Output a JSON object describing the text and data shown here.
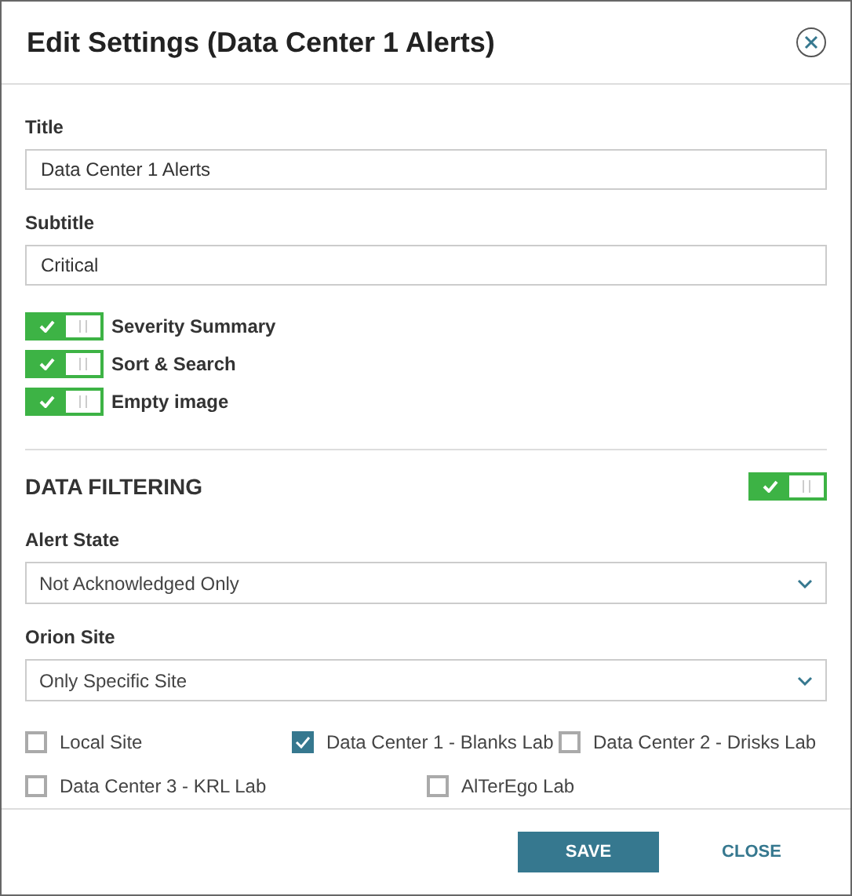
{
  "dialog": {
    "title": "Edit Settings (Data Center 1 Alerts)"
  },
  "fields": [
    {
      "label": "Title",
      "value": "Data Center 1 Alerts"
    },
    {
      "label": "Subtitle",
      "value": "Critical"
    }
  ],
  "toggles": [
    {
      "label": "Severity Summary",
      "on": true
    },
    {
      "label": "Sort & Search",
      "on": true
    },
    {
      "label": "Empty image",
      "on": true
    }
  ],
  "data_filtering": {
    "heading": "DATA FILTERING",
    "on": true,
    "dropdowns": [
      {
        "label": "Alert State",
        "value": "Not Acknowledged Only"
      },
      {
        "label": "Orion Site",
        "value": "Only Specific Site"
      }
    ],
    "sites": [
      [
        {
          "label": "Local Site",
          "checked": false
        },
        {
          "label": "Data Center 1 - Blanks Lab",
          "checked": true
        },
        {
          "label": "Data Center 2 - Drisks Lab",
          "checked": false
        }
      ],
      [
        {
          "label": "Data Center 3 - KRL Lab",
          "checked": false
        },
        {
          "label": "AlTerEgo Lab",
          "checked": false
        }
      ]
    ]
  },
  "buttons": {
    "save": "SAVE",
    "close": "CLOSE"
  }
}
